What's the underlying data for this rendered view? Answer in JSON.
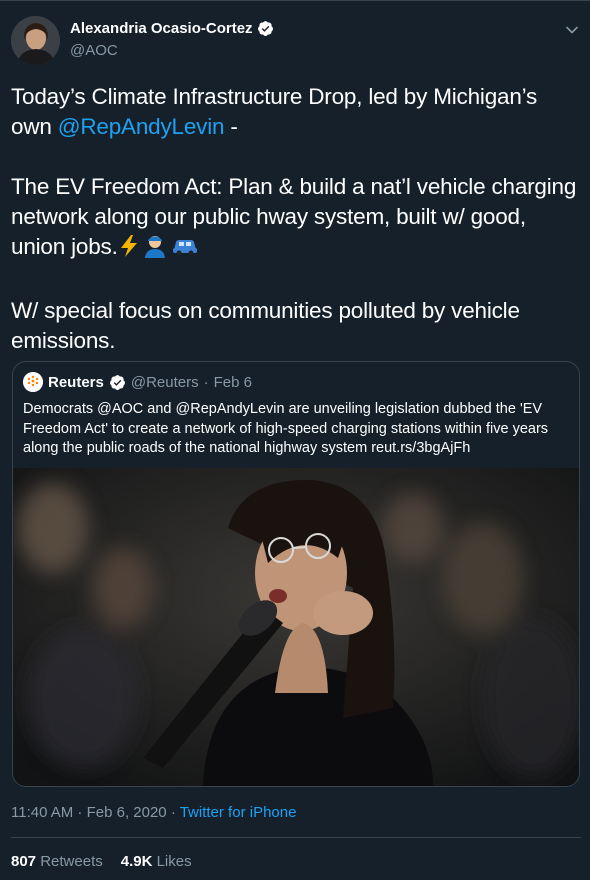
{
  "author": {
    "name": "Alexandria Ocasio-Cortez",
    "handle": "@AOC"
  },
  "tweet": {
    "line1": "Today’s Climate Infrastructure Drop, led by Michigan’s",
    "line2_prefix": "own ",
    "mention": "@RepAndyLevin",
    "line2_suffix": " -",
    "para2": "The EV Freedom Act: Plan & build a nat’l vehicle charging network along our public hway system, built w/ good, union jobs.",
    "para3": "W/ special focus on communities polluted by vehicle emissions.",
    "emoji_1": "⚡",
    "emoji_2": "👩‍🔧",
    "emoji_3": "🚙"
  },
  "quoted": {
    "name": "Reuters",
    "handle": "@Reuters",
    "dot": "·",
    "date": "Feb 6",
    "text": "Democrats @AOC and @RepAndyLevin are unveiling legislation dubbed the 'EV Freedom Act' to create a network of high-speed charging stations within five years along the public roads of the national highway system reut.rs/3bgAjFh"
  },
  "meta": {
    "time": "11:40 AM · Feb 6, 2020",
    "sep": " · ",
    "source": "Twitter for iPhone"
  },
  "stats": {
    "retweets_count": "807",
    "retweets_label": "Retweets",
    "likes_count": "4.9K",
    "likes_label": "Likes"
  },
  "colors": {
    "background": "#15202b",
    "link": "#1da1f2",
    "secondary_text": "#8899a6",
    "border": "#38444d"
  },
  "icons": [
    "verified-badge-icon",
    "chevron-down-icon"
  ]
}
